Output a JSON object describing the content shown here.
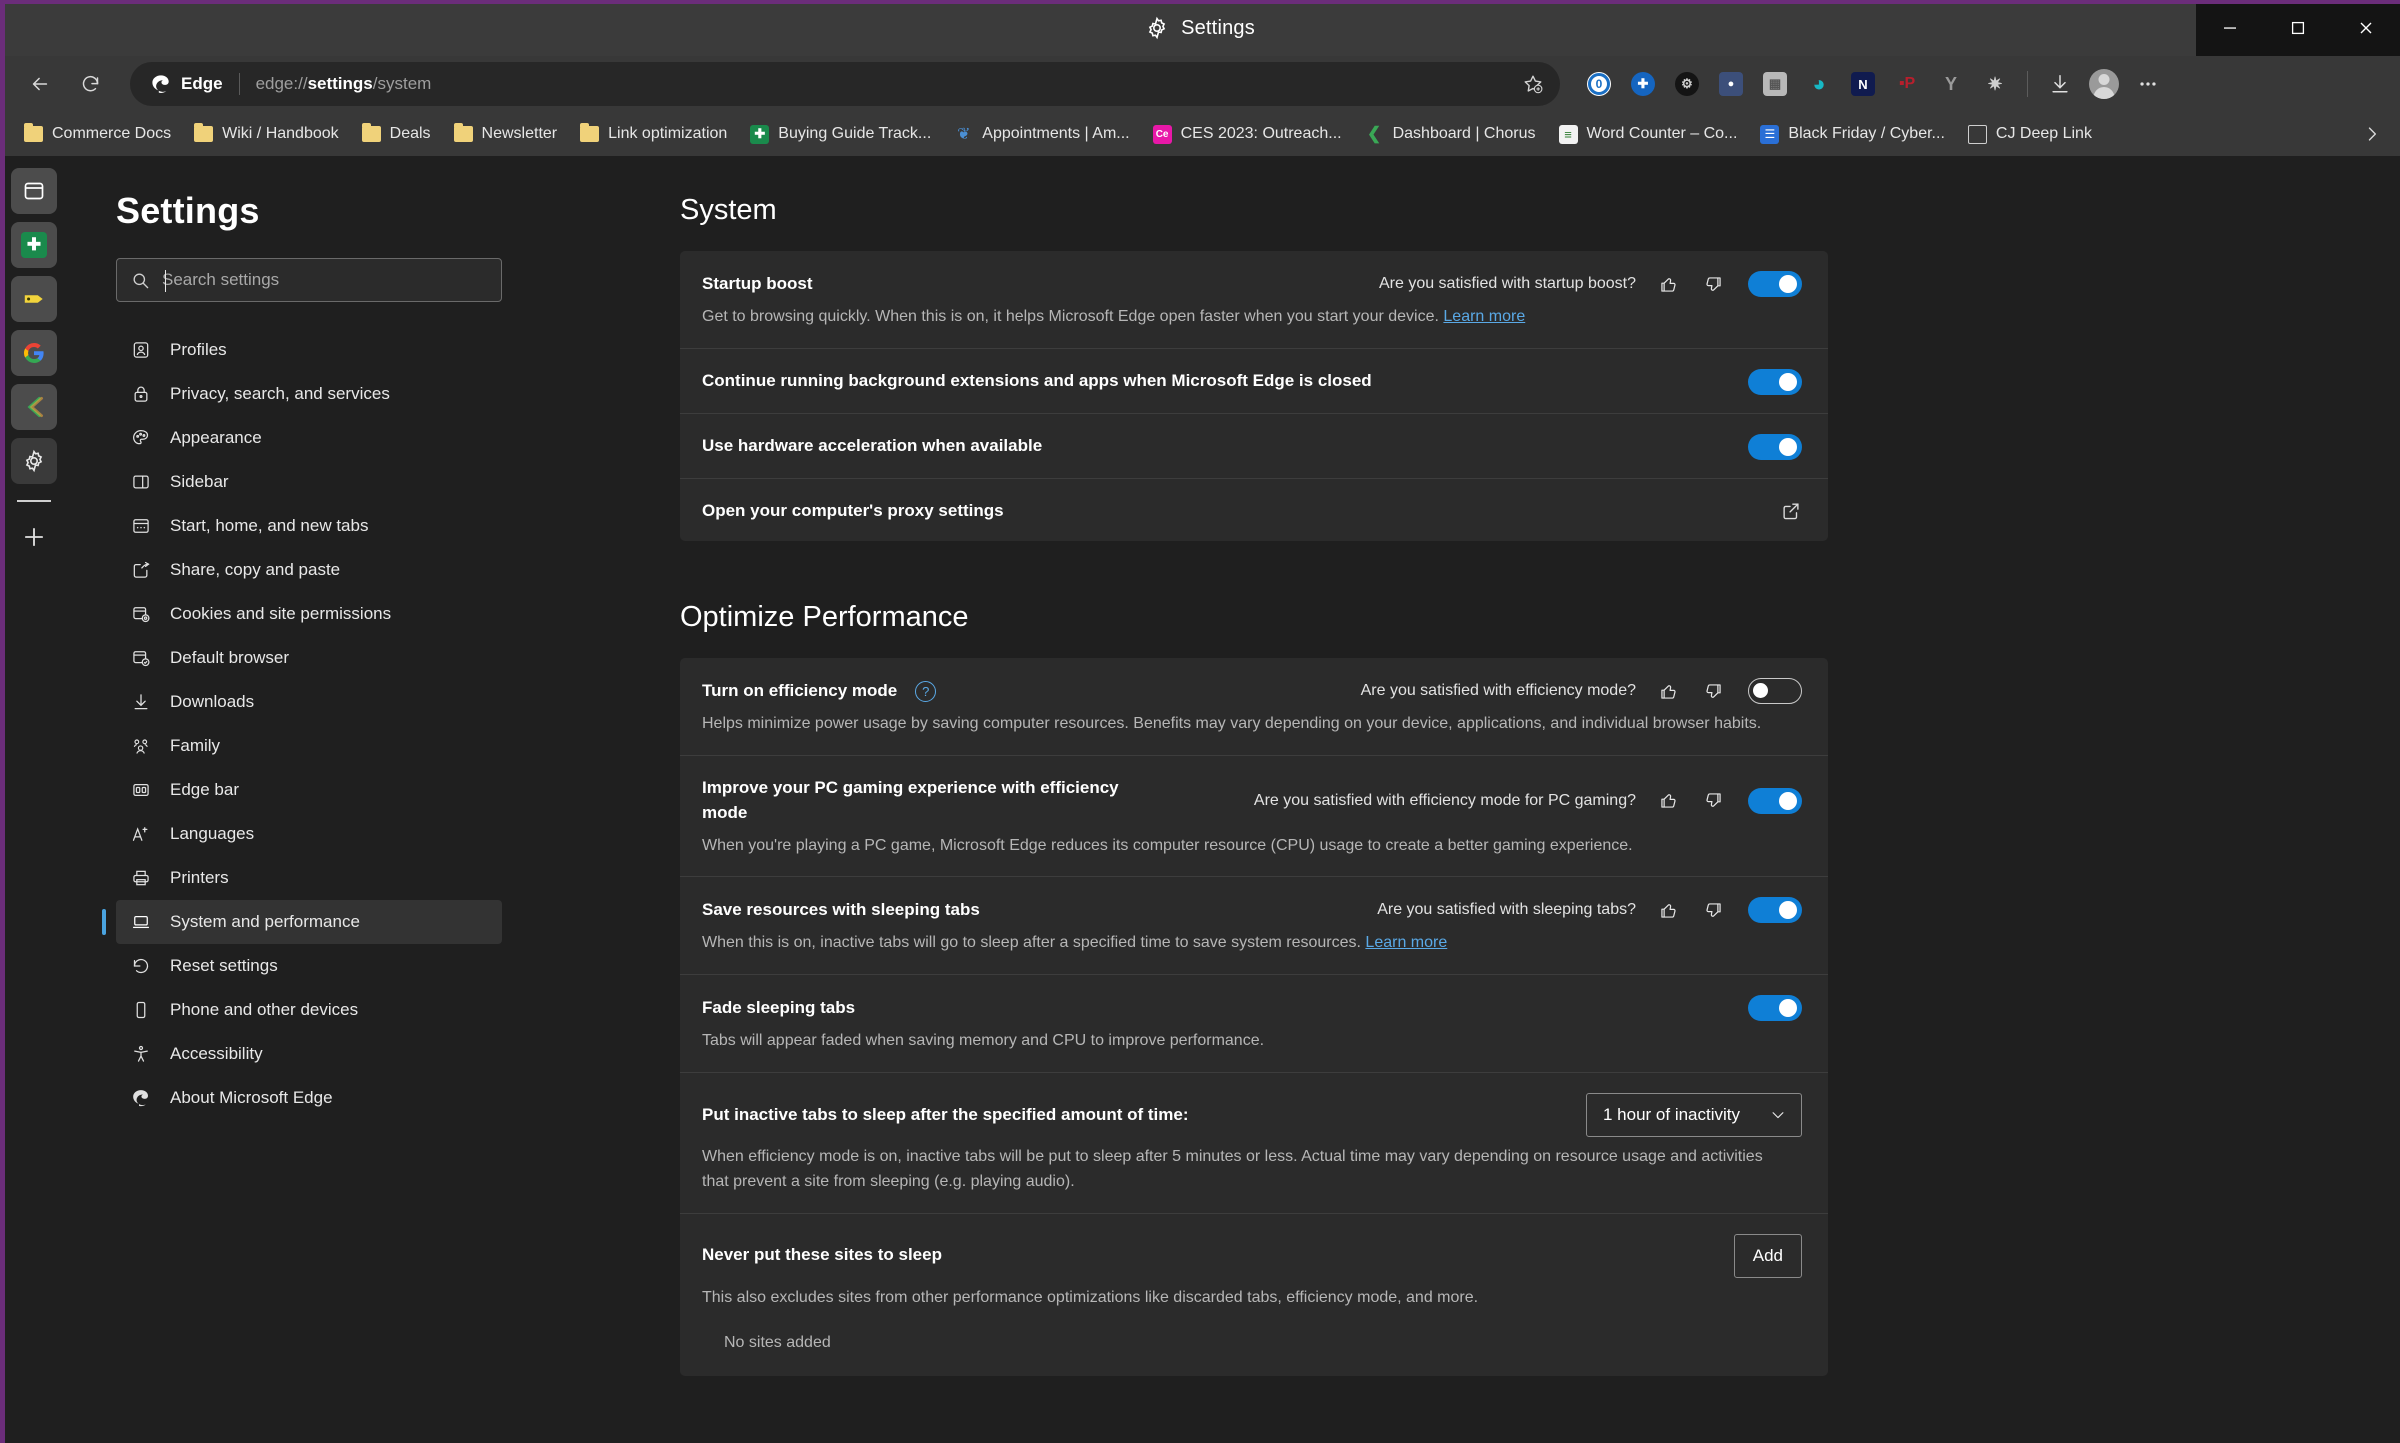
{
  "window": {
    "title": "Settings",
    "title_icon": "gear-icon",
    "controls": {
      "minimize": "Minimize",
      "maximize": "Maximize",
      "close": "Close"
    }
  },
  "toolbar": {
    "back": "Back",
    "refresh": "Refresh",
    "omnibox": {
      "badge_label": "Edge",
      "url_prefix": "edge://",
      "url_bold": "settings",
      "url_suffix": "/system",
      "favorite_icon": "star-add-icon"
    },
    "right_icons": [
      {
        "name": "browser-essentials-icon",
        "glyph": "0",
        "color": "#1a6fc4"
      },
      {
        "name": "extension-icon-blue",
        "glyph": "✦",
        "color": "#1565c0"
      },
      {
        "name": "extension-icon-dark-gear",
        "glyph": "⚙",
        "color": "#1a1a1a"
      },
      {
        "name": "extension-icon-person",
        "glyph": "●",
        "color": "#3c4f7a"
      },
      {
        "name": "extension-icon-gray",
        "glyph": "▦",
        "color": "#b8b8b8"
      },
      {
        "name": "extension-icon-teal-drop",
        "glyph": "◗",
        "color": "#17b8c4"
      },
      {
        "name": "extension-icon-n",
        "glyph": "N",
        "color": "#101b4f"
      },
      {
        "name": "extension-icon-red",
        "glyph": "P",
        "color": "#b81f2d"
      },
      {
        "name": "extension-icon-wishbone",
        "glyph": "Y",
        "color": "#9a9a9a"
      },
      {
        "name": "extension-icon-outline-gear",
        "glyph": "✵",
        "color": "#cfcfcf"
      }
    ],
    "downloads": "Downloads",
    "profile": "Profile",
    "more": "Settings and more"
  },
  "bookmarks": {
    "items": [
      {
        "label": "Commerce Docs",
        "icon": "folder-icon",
        "type": "folder"
      },
      {
        "label": "Wiki / Handbook",
        "icon": "folder-icon",
        "type": "folder"
      },
      {
        "label": "Deals",
        "icon": "folder-icon",
        "type": "folder"
      },
      {
        "label": "Newsletter",
        "icon": "folder-icon",
        "type": "folder"
      },
      {
        "label": "Link optimization",
        "icon": "folder-icon",
        "type": "folder"
      },
      {
        "label": "Buying Guide Track...",
        "icon": "sheets-favicon",
        "type": "site",
        "color": "#1a8a4c",
        "glyph": "✚"
      },
      {
        "label": "Appointments | Am...",
        "icon": "butterfly-favicon",
        "type": "site",
        "color": "#4a8fd4",
        "glyph": "❦"
      },
      {
        "label": "CES 2023: Outreach...",
        "icon": "ce-favicon",
        "type": "site",
        "color": "#e818a8",
        "glyph": "Ce"
      },
      {
        "label": "Dashboard | Chorus",
        "icon": "chorus-favicon",
        "type": "site",
        "color": "#3aa856",
        "glyph": "❮"
      },
      {
        "label": "Word Counter – Co...",
        "icon": "wordcounter-favicon",
        "type": "site",
        "color": "#f2f2f2",
        "glyph": "≡"
      },
      {
        "label": "Black Friday / Cyber...",
        "icon": "docs-favicon",
        "type": "site",
        "color": "#2a6fd6",
        "glyph": "☰"
      },
      {
        "label": "CJ Deep Link",
        "icon": "page-favicon",
        "type": "site",
        "color": "#dedede",
        "glyph": "☐"
      }
    ],
    "overflow": "Show more bookmarks"
  },
  "app_sidebar": {
    "items": [
      {
        "name": "copilot-icon",
        "glyph": "▣",
        "color": "#ffffff",
        "bg": "#4c4c4c"
      },
      {
        "name": "sheets-icon",
        "glyph": "✚",
        "color": "#ffffff",
        "bg": "#1a8a4c"
      },
      {
        "name": "tag-icon",
        "glyph": "◆",
        "color": "#f2d43c",
        "bg": "#4c4c4c"
      },
      {
        "name": "google-icon",
        "glyph": "G",
        "color": "#4285f4",
        "bg": "#4c4c4c"
      },
      {
        "name": "chorus-icon",
        "glyph": "❮",
        "color": "#3aa856",
        "bg": "#4c4c4c"
      },
      {
        "name": "gear-icon",
        "glyph": "⚙",
        "color": "#e8e8e8",
        "bg": "#3a3a3a"
      }
    ],
    "add_label": "Add"
  },
  "settings": {
    "title": "Settings",
    "search_placeholder": "Search settings",
    "search_value": "",
    "nav_items": [
      {
        "label": "Profiles",
        "icon": "profile-icon"
      },
      {
        "label": "Privacy, search, and services",
        "icon": "lock-icon"
      },
      {
        "label": "Appearance",
        "icon": "palette-icon"
      },
      {
        "label": "Sidebar",
        "icon": "sidebar-icon"
      },
      {
        "label": "Start, home, and new tabs",
        "icon": "home-window-icon"
      },
      {
        "label": "Share, copy and paste",
        "icon": "share-icon"
      },
      {
        "label": "Cookies and site permissions",
        "icon": "cookie-permissions-icon"
      },
      {
        "label": "Default browser",
        "icon": "default-browser-icon"
      },
      {
        "label": "Downloads",
        "icon": "download-icon"
      },
      {
        "label": "Family",
        "icon": "family-icon"
      },
      {
        "label": "Edge bar",
        "icon": "edge-bar-icon"
      },
      {
        "label": "Languages",
        "icon": "languages-icon"
      },
      {
        "label": "Printers",
        "icon": "printer-icon"
      },
      {
        "label": "System and performance",
        "icon": "laptop-icon",
        "active": true
      },
      {
        "label": "Reset settings",
        "icon": "reset-icon"
      },
      {
        "label": "Phone and other devices",
        "icon": "phone-icon"
      },
      {
        "label": "Accessibility",
        "icon": "accessibility-icon"
      },
      {
        "label": "About Microsoft Edge",
        "icon": "edge-logo-icon"
      }
    ]
  },
  "system_section": {
    "heading": "System",
    "rows": [
      {
        "label": "Startup boost",
        "desc_text": "Get to browsing quickly. When this is on, it helps Microsoft Edge open faster when you start your device.",
        "desc_link": "Learn more",
        "feedback_question": "Are you satisfied with startup boost?",
        "toggle_state": "on"
      },
      {
        "label": "Continue running background extensions and apps when Microsoft Edge is closed",
        "toggle_state": "on"
      },
      {
        "label": "Use hardware acceleration when available",
        "toggle_state": "on"
      },
      {
        "label": "Open your computer's proxy settings",
        "control": "external-link"
      }
    ]
  },
  "performance_section": {
    "heading": "Optimize Performance",
    "rows": [
      {
        "label": "Turn on efficiency mode",
        "has_help": true,
        "feedback_question": "Are you satisfied with efficiency mode?",
        "toggle_state": "off",
        "desc_text": "Helps minimize power usage by saving computer resources. Benefits may vary depending on your device, applications, and individual browser habits."
      },
      {
        "label": "Improve your PC gaming experience with efficiency mode",
        "feedback_question": "Are you satisfied with efficiency mode for PC gaming?",
        "toggle_state": "on",
        "desc_text": "When you're playing a PC game, Microsoft Edge reduces its computer resource (CPU) usage to create a better gaming experience."
      },
      {
        "label": "Save resources with sleeping tabs",
        "feedback_question": "Are you satisfied with sleeping tabs?",
        "toggle_state": "on",
        "desc_text": "When this is on, inactive tabs will go to sleep after a specified time to save system resources.",
        "desc_link": "Learn more"
      },
      {
        "label": "Fade sleeping tabs",
        "toggle_state": "on",
        "desc_text": "Tabs will appear faded when saving memory and CPU to improve performance."
      },
      {
        "label": "Put inactive tabs to sleep after the specified amount of time:",
        "select_value": "1 hour of inactivity",
        "desc_text": "When efficiency mode is on, inactive tabs will be put to sleep after 5 minutes or less. Actual time may vary depending on resource usage and activities that prevent a site from sleeping (e.g. playing audio)."
      },
      {
        "label": "Never put these sites to sleep",
        "button_label": "Add",
        "desc_text": "This also excludes sites from other performance optimizations like discarded tabs, efficiency mode, and more.",
        "empty_state": "No sites added"
      }
    ]
  },
  "colors": {
    "accent_blue": "#0f7fd6",
    "link_blue": "#5aa9e6",
    "window_purple": "#6b2d7a",
    "page_bg": "#1f1f1f",
    "card_bg": "#2b2b2b",
    "chrome_bg": "#383838"
  }
}
